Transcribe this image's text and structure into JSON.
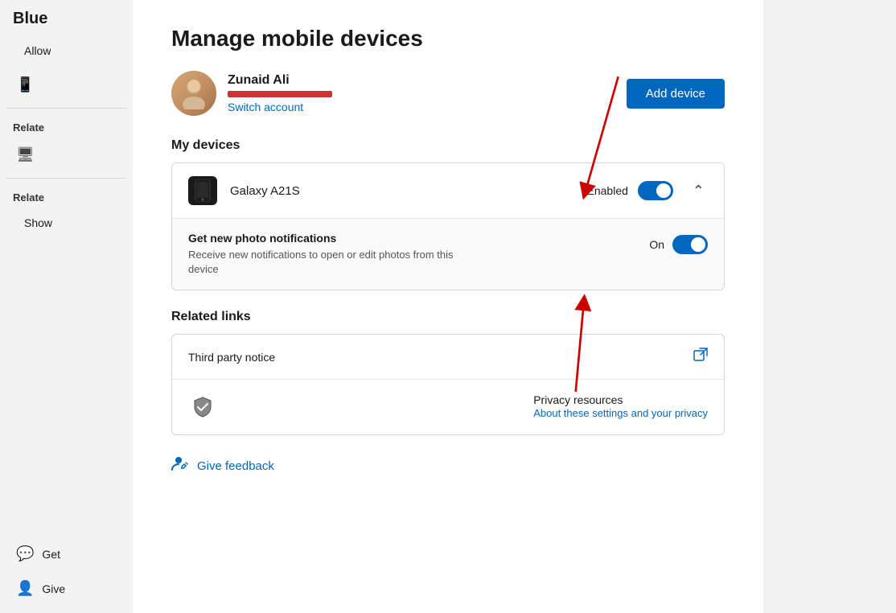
{
  "sidebar": {
    "header": "Blue",
    "items": [
      {
        "id": "allow",
        "label": "Allow",
        "icon": ""
      },
      {
        "id": "mobile",
        "label": "",
        "icon": "📱"
      },
      {
        "id": "related",
        "label": "Relate",
        "icon": ""
      },
      {
        "id": "remote",
        "label": "",
        "icon": "🖥"
      },
      {
        "id": "related2",
        "label": "Relate",
        "icon": ""
      },
      {
        "id": "show",
        "label": "Show",
        "icon": ""
      }
    ],
    "bottom_items": [
      {
        "id": "get",
        "label": "Get",
        "icon": "💬"
      },
      {
        "id": "give",
        "label": "Give",
        "icon": "👤"
      }
    ]
  },
  "main": {
    "title": "Manage mobile devices",
    "account": {
      "name": "Zunaid Ali",
      "switch_label": "Switch account",
      "add_device_label": "Add device"
    },
    "my_devices_title": "My devices",
    "device": {
      "name": "Galaxy A21S",
      "toggle_label": "Enabled",
      "toggle_on": true
    },
    "photo_notification": {
      "title": "Get new photo notifications",
      "description": "Receive new notifications to open or edit photos from this device",
      "toggle_label": "On",
      "toggle_on": true
    },
    "related_links_title": "Related links",
    "related_links": [
      {
        "id": "third-party",
        "title": "Third party notice",
        "has_external": true
      },
      {
        "id": "privacy",
        "title": "Privacy resources",
        "subtitle": "About these settings and your privacy",
        "has_icon": true
      }
    ],
    "feedback": {
      "label": "Give feedback"
    }
  }
}
